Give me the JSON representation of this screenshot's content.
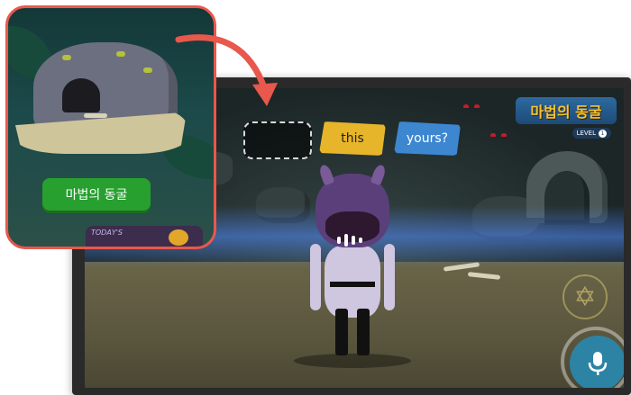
{
  "callout": {
    "button_label": "마법의 동굴",
    "peek_text": "TODAY'S"
  },
  "game": {
    "title_badge": "마법의 동굴",
    "level_label": "LEVEL",
    "level_number": "1",
    "words": [
      {
        "text": "",
        "state": "empty"
      },
      {
        "text": "this",
        "color": "#e6b52a"
      },
      {
        "text": "yours?",
        "color": "#3d87d1"
      }
    ]
  },
  "colors": {
    "callout_border": "#e8584c",
    "arrow": "#e8584c",
    "green_button": "#27a02f",
    "mic": "#2c83a3"
  },
  "icons": {
    "mic": "microphone-icon",
    "audio": "audio-wave-icon",
    "seal": "star-seal-icon",
    "arrow": "curved-arrow-icon"
  }
}
